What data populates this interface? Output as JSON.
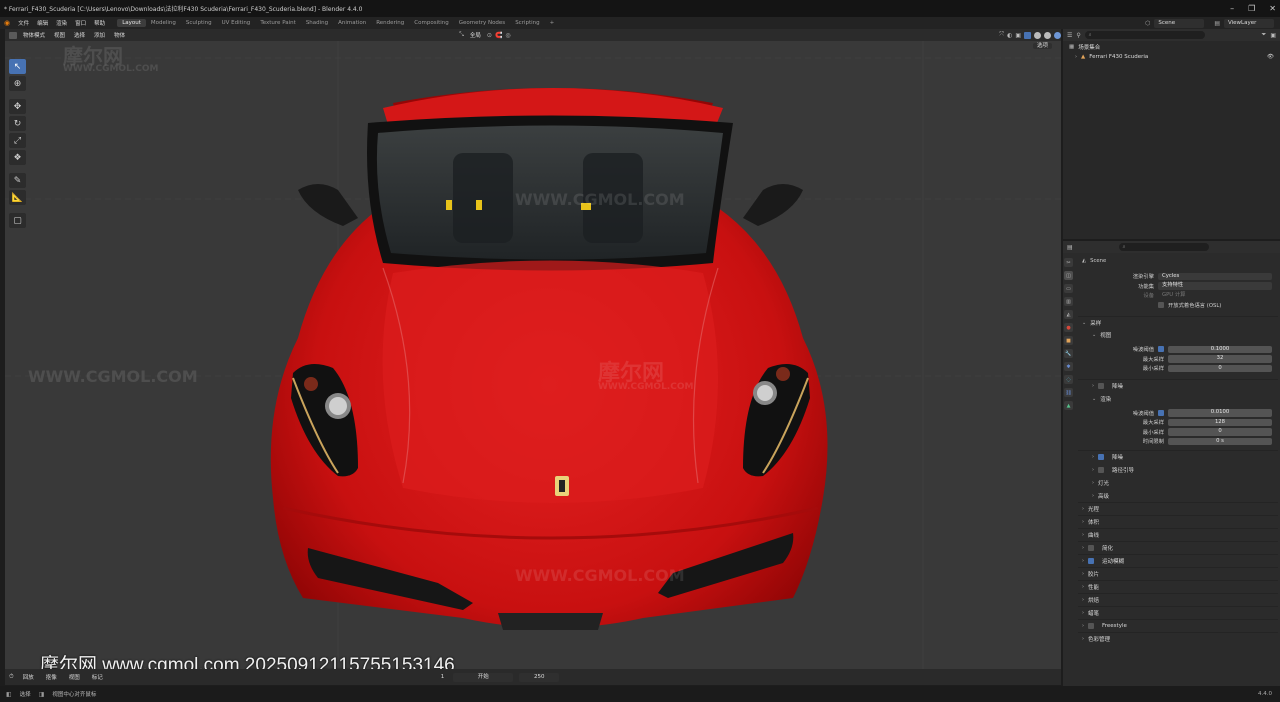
{
  "window": {
    "title": "* Ferrari_F430_Scuderia [C:\\Users\\Lenovo\\Downloads\\法拉利F430 Scuderia\\Ferrari_F430_Scuderia.blend] - Blender 4.4.0",
    "controls": [
      "–",
      "❐",
      "✕"
    ]
  },
  "menu": {
    "items": [
      "文件",
      "编辑",
      "渲染",
      "窗口",
      "帮助"
    ],
    "workspaces": [
      "Layout",
      "Modeling",
      "Sculpting",
      "UV Editing",
      "Texture Paint",
      "Shading",
      "Animation",
      "Rendering",
      "Compositing",
      "Geometry Nodes",
      "Scripting"
    ],
    "add_tab": "+",
    "scene": "Scene",
    "view_layer": "ViewLayer"
  },
  "viewport": {
    "mode": "物体模式",
    "menus": [
      "视图",
      "选择",
      "添加",
      "物体"
    ],
    "transform": "全局",
    "options": "选项"
  },
  "watermark": {
    "logo": "摩尔网",
    "url": "WWW.CGMOL.COM",
    "banner": "摩尔网 www.cgmol.com 20250912115755153146"
  },
  "timeline": {
    "menus": [
      "回放",
      "抠像",
      "视图",
      "标记"
    ],
    "center": "开始",
    "frame": "1",
    "end": "250"
  },
  "status": {
    "left1": "选择",
    "left2": "视图中心对齐鼠标",
    "version": "4.4.0"
  },
  "outliner": {
    "search_placeholder": "",
    "collection": "场景集合",
    "object": "Ferrari F430 Scuderia"
  },
  "properties": {
    "scene_label": "Scene",
    "render_engine_label": "渲染引擎",
    "render_engine": "Cycles",
    "feature_set_label": "功能集",
    "feature_set": "支持特性",
    "device_label": "设备",
    "device": "GPU 计算",
    "osl_label": "开放式着色语言 (OSL)",
    "sampling": "采样",
    "viewport_panel": "视图",
    "noise_threshold_label": "噪波阈值",
    "vp_noise_threshold": "0.1000",
    "max_samples_label": "最大采样",
    "vp_max_samples": "32",
    "min_samples_label": "最小采样",
    "vp_min_samples": "0",
    "denoise_label": "降噪",
    "render_panel": "渲染",
    "r_noise_threshold": "0.0100",
    "r_max_samples": "128",
    "r_min_samples": "0",
    "time_limit_label": "时间限制",
    "time_limit": "0 s",
    "r_denoise": "降噪",
    "path_guiding": "路径引导",
    "lights": "灯光",
    "advanced": "高级",
    "light_paths": "光程",
    "volumes": "体积",
    "curves": "曲线",
    "simplify": "简化",
    "motion_blur": "运动模糊",
    "film": "胶片",
    "performance": "性能",
    "bake": "烘焙",
    "grease_pencil": "蜡笔",
    "freestyle": "Freestyle",
    "color_management": "色彩管理"
  },
  "colors": {
    "accent": "#4772b3",
    "car_red": "#d81515",
    "viewport_bg": "#393939"
  }
}
